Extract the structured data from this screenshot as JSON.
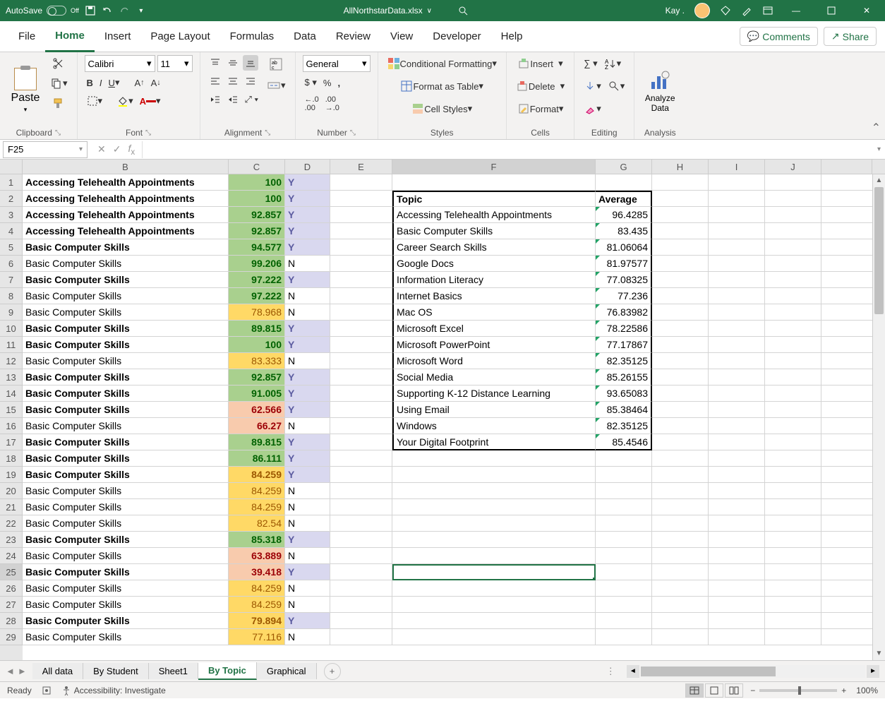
{
  "title": "AllNorthstarData.xlsx",
  "titlebar": {
    "autosave": "AutoSave",
    "autosave_state": "Off",
    "user": "Kay ."
  },
  "tabs": {
    "file": "File",
    "home": "Home",
    "insert": "Insert",
    "pagelayout": "Page Layout",
    "formulas": "Formulas",
    "data": "Data",
    "review": "Review",
    "view": "View",
    "developer": "Developer",
    "help": "Help",
    "comments": "Comments",
    "share": "Share"
  },
  "ribbon": {
    "paste": "Paste",
    "clipboard": "Clipboard",
    "font_name": "Calibri",
    "font_size": "11",
    "font": "Font",
    "alignment": "Alignment",
    "number_format": "General",
    "number": "Number",
    "cond_format": "Conditional Formatting",
    "format_table": "Format as Table",
    "cell_styles": "Cell Styles",
    "styles": "Styles",
    "insert": "Insert",
    "delete": "Delete",
    "format": "Format",
    "cells": "Cells",
    "editing": "Editing",
    "analyze": "Analyze Data",
    "analysis": "Analysis"
  },
  "namebox": "F25",
  "columns": [
    "B",
    "C",
    "D",
    "E",
    "F",
    "G",
    "H",
    "I",
    "J"
  ],
  "rows": [
    {
      "n": 1,
      "b": "Accessing Telehealth Appointments",
      "c": "100",
      "d": "Y",
      "bold": true,
      "cstyle": "cGreen",
      "dstyle": "cLav"
    },
    {
      "n": 2,
      "b": "Accessing Telehealth Appointments",
      "c": "100",
      "d": "Y",
      "bold": true,
      "cstyle": "cGreen",
      "dstyle": "cLav"
    },
    {
      "n": 3,
      "b": "Accessing Telehealth Appointments",
      "c": "92.857",
      "d": "Y",
      "bold": true,
      "cstyle": "cGreen",
      "dstyle": "cLav"
    },
    {
      "n": 4,
      "b": "Accessing Telehealth Appointments",
      "c": "92.857",
      "d": "Y",
      "bold": true,
      "cstyle": "cGreen",
      "dstyle": "cLav"
    },
    {
      "n": 5,
      "b": "Basic Computer Skills",
      "c": "94.577",
      "d": "Y",
      "bold": true,
      "cstyle": "cGreen",
      "dstyle": "cLav"
    },
    {
      "n": 6,
      "b": "Basic Computer Skills",
      "c": "99.206",
      "d": "N",
      "bold": false,
      "cstyle": "cGreen",
      "dstyle": ""
    },
    {
      "n": 7,
      "b": "Basic Computer Skills",
      "c": "97.222",
      "d": "Y",
      "bold": true,
      "cstyle": "cGreen",
      "dstyle": "cLav"
    },
    {
      "n": 8,
      "b": "Basic Computer Skills",
      "c": "97.222",
      "d": "N",
      "bold": false,
      "cstyle": "cGreen",
      "dstyle": ""
    },
    {
      "n": 9,
      "b": "Basic Computer Skills",
      "c": "78.968",
      "d": "N",
      "bold": false,
      "cstyle": "cYellow",
      "dstyle": ""
    },
    {
      "n": 10,
      "b": "Basic Computer Skills",
      "c": "89.815",
      "d": "Y",
      "bold": true,
      "cstyle": "cGreen",
      "dstyle": "cLav"
    },
    {
      "n": 11,
      "b": "Basic Computer Skills",
      "c": "100",
      "d": "Y",
      "bold": true,
      "cstyle": "cGreen",
      "dstyle": "cLav"
    },
    {
      "n": 12,
      "b": "Basic Computer Skills",
      "c": "83.333",
      "d": "N",
      "bold": false,
      "cstyle": "cYellow",
      "dstyle": ""
    },
    {
      "n": 13,
      "b": "Basic Computer Skills",
      "c": "92.857",
      "d": "Y",
      "bold": true,
      "cstyle": "cGreen",
      "dstyle": "cLav"
    },
    {
      "n": 14,
      "b": "Basic Computer Skills",
      "c": "91.005",
      "d": "Y",
      "bold": true,
      "cstyle": "cGreen",
      "dstyle": "cLav"
    },
    {
      "n": 15,
      "b": "Basic Computer Skills",
      "c": "62.566",
      "d": "Y",
      "bold": true,
      "cstyle": "cRed",
      "dstyle": "cLav"
    },
    {
      "n": 16,
      "b": "Basic Computer Skills",
      "c": "66.27",
      "d": "N",
      "bold": false,
      "cstyle": "cRed",
      "dstyle": ""
    },
    {
      "n": 17,
      "b": "Basic Computer Skills",
      "c": "89.815",
      "d": "Y",
      "bold": true,
      "cstyle": "cGreen",
      "dstyle": "cLav"
    },
    {
      "n": 18,
      "b": "Basic Computer Skills",
      "c": "86.111",
      "d": "Y",
      "bold": true,
      "cstyle": "cGreen",
      "dstyle": "cLav"
    },
    {
      "n": 19,
      "b": "Basic Computer Skills",
      "c": "84.259",
      "d": "Y",
      "bold": true,
      "cstyle": "cYellow",
      "dstyle": "cLav"
    },
    {
      "n": 20,
      "b": "Basic Computer Skills",
      "c": "84.259",
      "d": "N",
      "bold": false,
      "cstyle": "cYellow",
      "dstyle": ""
    },
    {
      "n": 21,
      "b": "Basic Computer Skills",
      "c": "84.259",
      "d": "N",
      "bold": false,
      "cstyle": "cYellow",
      "dstyle": ""
    },
    {
      "n": 22,
      "b": "Basic Computer Skills",
      "c": "82.54",
      "d": "N",
      "bold": false,
      "cstyle": "cYellow",
      "dstyle": ""
    },
    {
      "n": 23,
      "b": "Basic Computer Skills",
      "c": "85.318",
      "d": "Y",
      "bold": true,
      "cstyle": "cGreen",
      "dstyle": "cLav"
    },
    {
      "n": 24,
      "b": "Basic Computer Skills",
      "c": "63.889",
      "d": "N",
      "bold": false,
      "cstyle": "cRed",
      "dstyle": ""
    },
    {
      "n": 25,
      "b": "Basic Computer Skills",
      "c": "39.418",
      "d": "Y",
      "bold": true,
      "cstyle": "cRed",
      "dstyle": "cLav"
    },
    {
      "n": 26,
      "b": "Basic Computer Skills",
      "c": "84.259",
      "d": "N",
      "bold": false,
      "cstyle": "cYellow",
      "dstyle": ""
    },
    {
      "n": 27,
      "b": "Basic Computer Skills",
      "c": "84.259",
      "d": "N",
      "bold": false,
      "cstyle": "cYellow",
      "dstyle": ""
    },
    {
      "n": 28,
      "b": "Basic Computer Skills",
      "c": "79.894",
      "d": "Y",
      "bold": true,
      "cstyle": "cYellow",
      "dstyle": "cLav"
    },
    {
      "n": 29,
      "b": "Basic Computer Skills",
      "c": "77.116",
      "d": "N",
      "bold": false,
      "cstyle": "cYellow",
      "dstyle": ""
    }
  ],
  "summary": {
    "header_topic": "Topic",
    "header_avg": "Average",
    "rows": [
      {
        "topic": "Accessing Telehealth Appointments",
        "avg": "96.4285"
      },
      {
        "topic": "Basic Computer Skills",
        "avg": "83.435"
      },
      {
        "topic": "Career Search Skills",
        "avg": "81.06064"
      },
      {
        "topic": "Google Docs",
        "avg": "81.97577"
      },
      {
        "topic": "Information Literacy",
        "avg": "77.08325"
      },
      {
        "topic": "Internet Basics",
        "avg": "77.236"
      },
      {
        "topic": "Mac OS",
        "avg": "76.83982"
      },
      {
        "topic": "Microsoft Excel",
        "avg": "78.22586"
      },
      {
        "topic": "Microsoft PowerPoint",
        "avg": "77.17867"
      },
      {
        "topic": "Microsoft Word",
        "avg": "82.35125"
      },
      {
        "topic": "Social Media",
        "avg": "85.26155"
      },
      {
        "topic": "Supporting K-12 Distance Learning",
        "avg": "93.65083"
      },
      {
        "topic": "Using Email",
        "avg": "85.38464"
      },
      {
        "topic": "Windows",
        "avg": "82.35125"
      },
      {
        "topic": "Your Digital Footprint",
        "avg": "85.4546"
      }
    ]
  },
  "sheets": {
    "all_data": "All data",
    "by_student": "By Student",
    "sheet1": "Sheet1",
    "by_topic": "By Topic",
    "graphical": "Graphical"
  },
  "status": {
    "ready": "Ready",
    "accessibility": "Accessibility: Investigate",
    "zoom": "100%"
  }
}
